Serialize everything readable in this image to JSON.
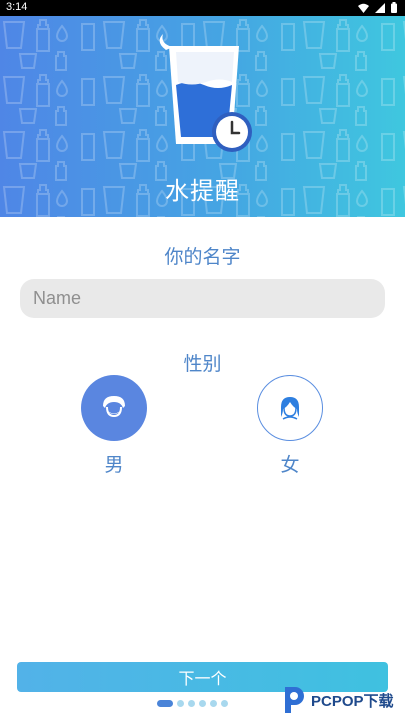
{
  "status_bar": {
    "time": "3:14"
  },
  "header": {
    "title": "水提醒"
  },
  "form": {
    "name_label": "你的名字",
    "name_value": "",
    "name_placeholder": "Name",
    "gender_label": "性别",
    "gender_options": [
      {
        "label": "男",
        "icon": "male-avatar-icon",
        "selected": true
      },
      {
        "label": "女",
        "icon": "female-avatar-icon",
        "selected": false
      }
    ]
  },
  "footer": {
    "next_label": "下一个",
    "page_indicator": {
      "count": 6,
      "current": 1
    }
  },
  "watermark": {
    "text": "PCPOP下载"
  },
  "colors": {
    "header_gradient": [
      "#4f86e6",
      "#3fc7df"
    ],
    "accent": "#5a86e0",
    "label_text": "#4f86c9",
    "button_gradient": [
      "#52b2e8",
      "#3fc1e0"
    ],
    "input_background": "#e9e9e9"
  }
}
